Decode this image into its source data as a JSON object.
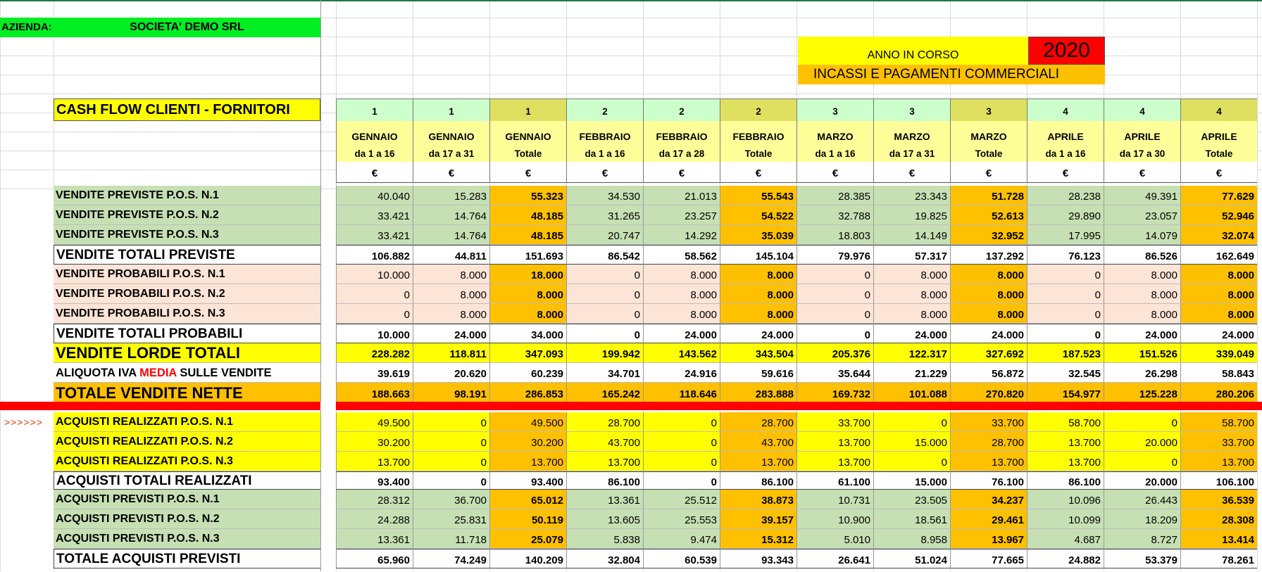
{
  "company": {
    "label": "AZIENDA:",
    "name": "SOCIETA' DEMO SRL"
  },
  "year": {
    "label": "ANNO IN CORSO",
    "value": "2020"
  },
  "subtitle": "INCASSI E PAGAMENTI COMMERCIALI",
  "title": "CASH FLOW CLIENTI - FORNITORI",
  "arrow": ">>>>>>",
  "columns": [
    {
      "num": "1",
      "month": "GENNAIO",
      "sub": "da 1 a 16",
      "cur": "€",
      "kind": "g"
    },
    {
      "num": "1",
      "month": "GENNAIO",
      "sub": "da 17 a 31",
      "cur": "€",
      "kind": "g"
    },
    {
      "num": "1",
      "month": "GENNAIO",
      "sub": "Totale",
      "cur": "€",
      "kind": "t"
    },
    {
      "num": "2",
      "month": "FEBBRAIO",
      "sub": "da 1 a 16",
      "cur": "€",
      "kind": "g"
    },
    {
      "num": "2",
      "month": "FEBBRAIO",
      "sub": "da 17 a 28",
      "cur": "€",
      "kind": "g"
    },
    {
      "num": "2",
      "month": "FEBBRAIO",
      "sub": "Totale",
      "cur": "€",
      "kind": "t"
    },
    {
      "num": "3",
      "month": "MARZO",
      "sub": "da 1 a 16",
      "cur": "€",
      "kind": "g"
    },
    {
      "num": "3",
      "month": "MARZO",
      "sub": "da 17 a 31",
      "cur": "€",
      "kind": "g"
    },
    {
      "num": "3",
      "month": "MARZO",
      "sub": "Totale",
      "cur": "€",
      "kind": "t"
    },
    {
      "num": "4",
      "month": "APRILE",
      "sub": "da 1 a 16",
      "cur": "€",
      "kind": "g"
    },
    {
      "num": "4",
      "month": "APRILE",
      "sub": "da 17 a 30",
      "cur": "€",
      "kind": "g"
    },
    {
      "num": "4",
      "month": "APRILE",
      "sub": "Totale",
      "cur": "€",
      "kind": "t"
    }
  ],
  "rows": [
    {
      "label": "VENDITE PREVISTE P.O.S. N.1",
      "style": "green",
      "values": [
        "40.040",
        "15.283",
        "55.323",
        "34.530",
        "21.013",
        "55.543",
        "28.385",
        "23.343",
        "51.728",
        "28.238",
        "49.391",
        "77.629"
      ]
    },
    {
      "label": "VENDITE PREVISTE P.O.S. N.2",
      "style": "green",
      "values": [
        "33.421",
        "14.764",
        "48.185",
        "31.265",
        "23.257",
        "54.522",
        "32.788",
        "19.825",
        "52.613",
        "29.890",
        "23.057",
        "52.946"
      ]
    },
    {
      "label": "VENDITE PREVISTE P.O.S. N.3",
      "style": "green",
      "values": [
        "33.421",
        "14.764",
        "48.185",
        "20.747",
        "14.292",
        "35.039",
        "18.803",
        "14.149",
        "32.952",
        "17.995",
        "14.079",
        "32.074"
      ]
    },
    {
      "label": "VENDITE TOTALI PREVISTE",
      "style": "totwhite",
      "values": [
        "106.882",
        "44.811",
        "151.693",
        "86.542",
        "58.562",
        "145.104",
        "79.976",
        "57.317",
        "137.292",
        "76.123",
        "86.526",
        "162.649"
      ]
    },
    {
      "label": "VENDITE PROBABILI P.O.S. N.1",
      "style": "pink",
      "values": [
        "10.000",
        "8.000",
        "18.000",
        "0",
        "8.000",
        "8.000",
        "0",
        "8.000",
        "8.000",
        "0",
        "8.000",
        "8.000"
      ]
    },
    {
      "label": "VENDITE PROBABILI P.O.S. N.2",
      "style": "pink",
      "values": [
        "0",
        "8.000",
        "8.000",
        "0",
        "8.000",
        "8.000",
        "0",
        "8.000",
        "8.000",
        "0",
        "8.000",
        "8.000"
      ]
    },
    {
      "label": "VENDITE PROBABILI P.O.S. N.3",
      "style": "pink",
      "values": [
        "0",
        "8.000",
        "8.000",
        "0",
        "8.000",
        "8.000",
        "0",
        "8.000",
        "8.000",
        "0",
        "8.000",
        "8.000"
      ]
    },
    {
      "label": "VENDITE TOTALI PROBABILI",
      "style": "totwhite",
      "values": [
        "10.000",
        "24.000",
        "34.000",
        "0",
        "24.000",
        "24.000",
        "0",
        "24.000",
        "24.000",
        "0",
        "24.000",
        "24.000"
      ]
    },
    {
      "label": "VENDITE LORDE TOTALI",
      "style": "yellowbig",
      "values": [
        "228.282",
        "118.811",
        "347.093",
        "199.942",
        "143.562",
        "343.504",
        "205.376",
        "122.317",
        "327.692",
        "187.523",
        "151.526",
        "339.049"
      ]
    },
    {
      "label_pre": "ALIQUOTA IVA ",
      "label_red": "MEDIA",
      "label_post": " SULLE VENDITE",
      "style": "iva",
      "values": [
        "39.619",
        "20.620",
        "60.239",
        "34.701",
        "24.916",
        "59.616",
        "35.644",
        "21.229",
        "56.872",
        "32.545",
        "26.298",
        "58.843"
      ]
    },
    {
      "label": "TOTALE VENDITE NETTE",
      "style": "orangebig",
      "values": [
        "188.663",
        "98.191",
        "286.853",
        "165.242",
        "118.646",
        "283.888",
        "169.732",
        "101.088",
        "270.820",
        "154.977",
        "125.228",
        "280.206"
      ]
    },
    {
      "label": "ACQUISTI REALIZZATI P.O.S. N.1",
      "style": "yellow",
      "values": [
        "49.500",
        "0",
        "49.500",
        "28.700",
        "0",
        "28.700",
        "33.700",
        "0",
        "33.700",
        "58.700",
        "0",
        "58.700"
      ]
    },
    {
      "label": "ACQUISTI REALIZZATI P.O.S. N.2",
      "style": "yellow",
      "values": [
        "30.200",
        "0",
        "30.200",
        "43.700",
        "0",
        "43.700",
        "13.700",
        "15.000",
        "28.700",
        "13.700",
        "20.000",
        "33.700"
      ]
    },
    {
      "label": "ACQUISTI REALIZZATI P.O.S. N.3",
      "style": "yellow",
      "values": [
        "13.700",
        "0",
        "13.700",
        "13.700",
        "0",
        "13.700",
        "13.700",
        "0",
        "13.700",
        "13.700",
        "0",
        "13.700"
      ]
    },
    {
      "label": "ACQUISTI TOTALI REALIZZATI",
      "style": "totwhite",
      "values": [
        "93.400",
        "0",
        "93.400",
        "86.100",
        "0",
        "86.100",
        "61.100",
        "15.000",
        "76.100",
        "86.100",
        "20.000",
        "106.100"
      ]
    },
    {
      "label": "ACQUISTI PREVISTI P.O.S. N.1",
      "style": "green",
      "values": [
        "28.312",
        "36.700",
        "65.012",
        "13.361",
        "25.512",
        "38.873",
        "10.731",
        "23.505",
        "34.237",
        "10.096",
        "26.443",
        "36.539"
      ]
    },
    {
      "label": "ACQUISTI PREVISTI P.O.S. N.2",
      "style": "green",
      "values": [
        "24.288",
        "25.831",
        "50.119",
        "13.605",
        "25.553",
        "39.157",
        "10.900",
        "18.561",
        "29.461",
        "10.099",
        "18.209",
        "28.308"
      ]
    },
    {
      "label": "ACQUISTI PREVISTI P.O.S. N.3",
      "style": "green",
      "values": [
        "13.361",
        "11.718",
        "25.079",
        "5.838",
        "9.474",
        "15.312",
        "5.010",
        "8.958",
        "13.967",
        "4.687",
        "8.727",
        "13.414"
      ]
    },
    {
      "label": "TOTALE ACQUISTI PREVISTI",
      "style": "totwhite",
      "values": [
        "65.960",
        "74.249",
        "140.209",
        "32.804",
        "60.539",
        "93.343",
        "26.641",
        "51.024",
        "77.665",
        "24.882",
        "53.379",
        "78.261"
      ]
    }
  ],
  "colors": {
    "green": "#c6e0b4",
    "pink": "#fce4d6",
    "yellow": "#ffff00",
    "orange": "#ffc000",
    "total": "#ffc000",
    "red": "#ff0000",
    "grid": "#dadada"
  }
}
